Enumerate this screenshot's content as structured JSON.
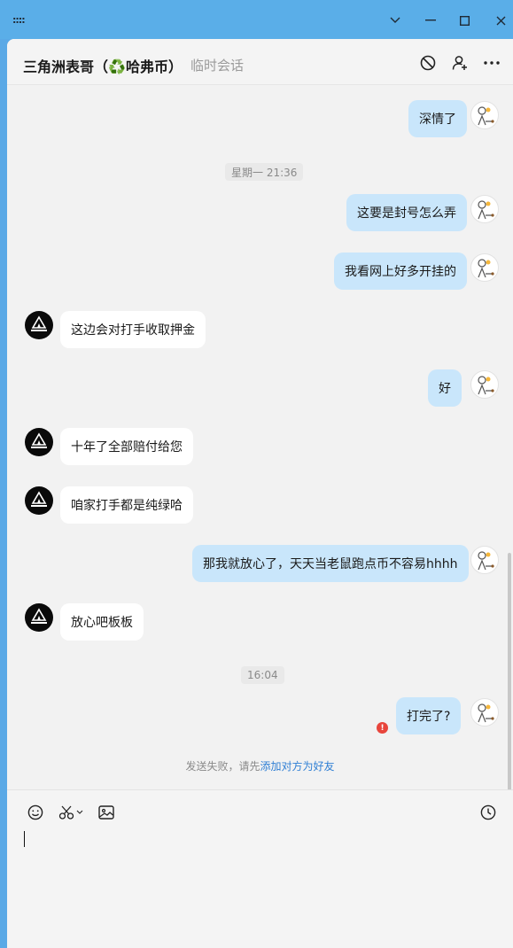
{
  "window": {
    "grip_glyph": "::::",
    "controls": [
      "collapse",
      "minimize",
      "maximize",
      "close"
    ]
  },
  "header": {
    "title_prefix": "三角洲表哥（",
    "title_emoji": "♻️",
    "title_suffix": "哈弗币）",
    "subtitle": "临时会话",
    "icons": [
      "block-icon",
      "add-friend-icon",
      "more-icon"
    ]
  },
  "messages": [
    {
      "type": "out",
      "text": "深情了"
    },
    {
      "type": "time",
      "text": "星期一 21:36"
    },
    {
      "type": "out",
      "text": "这要是封号怎么弄"
    },
    {
      "type": "out",
      "text": "我看网上好多开挂的"
    },
    {
      "type": "in",
      "text": "这边会对打手收取押金"
    },
    {
      "type": "out",
      "text": "好"
    },
    {
      "type": "in",
      "text": "十年了全部赔付给您"
    },
    {
      "type": "in",
      "text": "咱家打手都是纯绿哈"
    },
    {
      "type": "out",
      "text": "那我就放心了，天天当老鼠跑点币不容易hhhh"
    },
    {
      "type": "in",
      "text": "放心吧板板"
    },
    {
      "type": "time",
      "text": "16:04"
    },
    {
      "type": "out",
      "text": "打完了?",
      "failed": true
    }
  ],
  "fail_mark": "!",
  "notice": {
    "prefix": "发送失败，请先",
    "link": "添加对方为好友"
  },
  "composer": {
    "tools": [
      "emoji-icon",
      "scissors-icon",
      "image-icon",
      "history-icon"
    ],
    "input_value": ""
  },
  "colors": {
    "titlebar": "#5aaee8",
    "outgoing_bubble": "#c9e6fb",
    "incoming_bubble": "#ffffff",
    "link": "#2f7fd4",
    "fail": "#e8453c"
  }
}
